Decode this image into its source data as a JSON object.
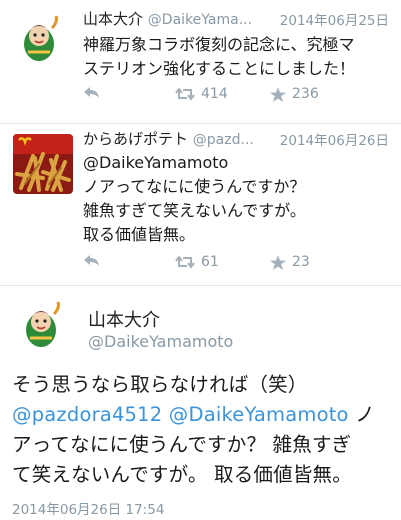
{
  "tweets": [
    {
      "name": "山本大介",
      "handle": "@DaikeYama...",
      "date": "2014年06月25日",
      "lines": [
        "神羅万象コラボ復刻の記念に、究極マ",
        "ステリオン強化することにしました！"
      ],
      "retweets": "414",
      "favorites": "236"
    },
    {
      "name": "からあげポテト",
      "handle": "@pazd...",
      "date": "2014年06月26日",
      "lines": [
        "@DaikeYamamoto",
        "ノアってなにに使うんですか？",
        "雑魚すぎて笑えないんですが。",
        "取る価値皆無。"
      ],
      "retweets": "61",
      "favorites": "23"
    }
  ],
  "detail": {
    "name": "山本大介",
    "handle": "@DaikeYamamoto",
    "line1": "そう思うなら取らなければ（笑）",
    "mention1": "@pazdora4512",
    "mention2": "@DaikeYamamoto",
    "line2_tail": " ノ",
    "line3": "アってなにに使うんですか？ 雑魚すぎ",
    "line4": "て笑えないんですが。 取る価値皆無。",
    "timestamp": "2014年06月26日 17:54"
  },
  "colors": {
    "mention": "#3b94d9",
    "meta": "#8899a6",
    "divider": "#e1e8ed"
  },
  "icons": [
    "reply-icon",
    "retweet-icon",
    "favorite-icon"
  ]
}
